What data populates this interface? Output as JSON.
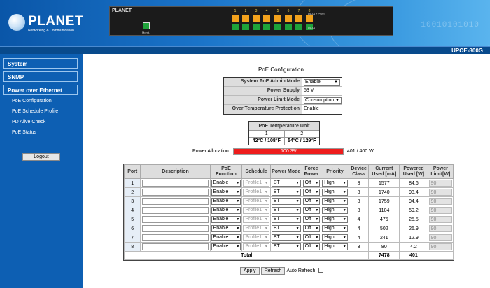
{
  "header": {
    "brand": "PLANET",
    "tagline": "Networking & Communication",
    "device_logo": "PLANET",
    "mgmt_label": "Mgmt.",
    "port_numbers": [
      "1",
      "2",
      "3",
      "4",
      "5",
      "6",
      "7",
      "8"
    ],
    "data_label_top": "DATA + PWR",
    "data_label_bottom": "DATA",
    "model": "UPOE-800G",
    "bits": "10010101010",
    "colors": {
      "accent": "#0d5fb3",
      "port_led": "#f3a21c",
      "link_led": "#1ea33a"
    }
  },
  "sidebar": {
    "sections": [
      "System",
      "SNMP",
      "Power over Ethernet"
    ],
    "items": [
      "PoE Configuration",
      "PoE Schedule Profile",
      "PD Alive Check",
      "PoE Status"
    ],
    "logout": "Logout"
  },
  "main": {
    "title": "PoE Configuration",
    "poe_settings": [
      {
        "label": "System PoE Admin Mode",
        "value": "Enable",
        "type": "select"
      },
      {
        "label": "Power Supply",
        "value": "53 V",
        "type": "text"
      },
      {
        "label": "Power Limit Mode",
        "value": "Consumption",
        "type": "select"
      },
      {
        "label": "Over Temperature Protection",
        "value": "Enable",
        "type": "text"
      }
    ],
    "temperature": {
      "title": "PoE Temperature Unit",
      "units": [
        "1",
        "2"
      ],
      "values": [
        "42°C / 108°F",
        "54°C / 129°F"
      ]
    },
    "allocation": {
      "label": "Power Allocation",
      "percent_text": "100.3%",
      "percent": 100.3,
      "value": "401 / 400 W"
    },
    "table": {
      "columns": [
        "Port",
        "Description",
        "PoE Function",
        "Schedule",
        "Power Mode",
        "Force Power",
        "Priority",
        "Device Class",
        "Current Used [mA]",
        "Powered Used [W]",
        "Power Limit[W]"
      ],
      "rows": [
        {
          "port": "1",
          "function": "Enable",
          "schedule": "Profile1",
          "mode": "BT",
          "force": "Off",
          "priority": "High",
          "class": "8",
          "current": "1577",
          "power": "84.6",
          "limit": "90"
        },
        {
          "port": "2",
          "function": "Enable",
          "schedule": "Profile1",
          "mode": "BT",
          "force": "Off",
          "priority": "High",
          "class": "8",
          "current": "1740",
          "power": "93.4",
          "limit": "90"
        },
        {
          "port": "3",
          "function": "Enable",
          "schedule": "Profile1",
          "mode": "BT",
          "force": "Off",
          "priority": "High",
          "class": "8",
          "current": "1759",
          "power": "94.4",
          "limit": "90"
        },
        {
          "port": "4",
          "function": "Enable",
          "schedule": "Profile1",
          "mode": "BT",
          "force": "Off",
          "priority": "High",
          "class": "8",
          "current": "1104",
          "power": "59.2",
          "limit": "90"
        },
        {
          "port": "5",
          "function": "Enable",
          "schedule": "Profile1",
          "mode": "BT",
          "force": "Off",
          "priority": "High",
          "class": "4",
          "current": "475",
          "power": "25.5",
          "limit": "90"
        },
        {
          "port": "6",
          "function": "Enable",
          "schedule": "Profile1",
          "mode": "BT",
          "force": "Off",
          "priority": "High",
          "class": "4",
          "current": "502",
          "power": "26.9",
          "limit": "90"
        },
        {
          "port": "7",
          "function": "Enable",
          "schedule": "Profile1",
          "mode": "BT",
          "force": "Off",
          "priority": "High",
          "class": "4",
          "current": "241",
          "power": "12.9",
          "limit": "90"
        },
        {
          "port": "8",
          "function": "Enable",
          "schedule": "Profile1",
          "mode": "BT",
          "force": "Off",
          "priority": "High",
          "class": "3",
          "current": "80",
          "power": "4.2",
          "limit": "90"
        }
      ],
      "total_label": "Total",
      "total_current": "7478",
      "total_power": "401"
    },
    "buttons": {
      "apply": "Apply",
      "refresh": "Refresh",
      "auto_refresh": "Auto Refresh"
    }
  }
}
